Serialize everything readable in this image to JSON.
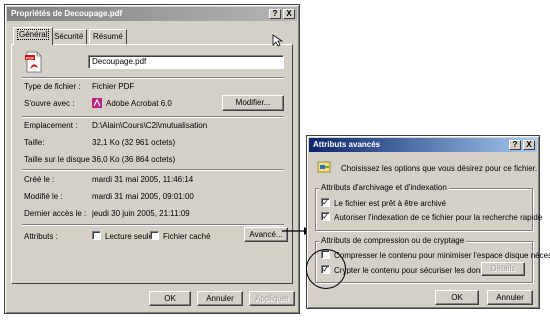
{
  "props": {
    "title": "Propriétés de Decoupage.pdf",
    "tabs": [
      "Général",
      "Sécurité",
      "Résumé"
    ],
    "filename": "Decoupage.pdf",
    "type_label": "Type de fichier :",
    "type_value": "Fichier PDF",
    "opens_label": "S'ouvre avec :",
    "opens_value": "Adobe Acrobat 6.0",
    "modify_btn": "Modifier...",
    "location_label": "Emplacement :",
    "location_value": "D:\\Alain\\Cours\\C2i\\mutualisation",
    "size_label": "Taille:",
    "size_value": "32,1 Ko (32 961 octets)",
    "disksize_label": "Taille sur le disque :",
    "disksize_value": "36,0 Ko (36 864 octets)",
    "created_label": "Créé le :",
    "created_value": "mardi 31 mai 2005, 11:46:14",
    "modified_label": "Modifié le :",
    "modified_value": "mardi 31 mai 2005, 09:01:00",
    "accessed_label": "Dernier accès le :",
    "accessed_value": "jeudi 30 juin 2005, 21:11:09",
    "attributes_label": "Attributs :",
    "readonly_label": "Lecture seule",
    "hidden_label": "Fichier caché",
    "advanced_btn": "Avancé...",
    "ok": "OK",
    "cancel": "Annuler",
    "apply": "Appliquer"
  },
  "adv": {
    "title": "Attributs avancés",
    "intro": "Choisissez les options que vous désirez pour ce fichier.",
    "group1_title": "Attributs d'archivage et d'indexation",
    "archive_label": "Le fichier est prêt à être archivé",
    "index_label": "Autoriser l'indexation de ce fichier pour la recherche rapide",
    "group2_title": "Attributs de compression ou de cryptage",
    "compress_label": "Compresser le contenu pour minimiser l'espace disque nécessaire",
    "encrypt_label": "Crypter le contenu pour sécuriser les données",
    "details_btn": "Détails",
    "ok": "OK",
    "cancel": "Annuler"
  },
  "titlebar_buttons": {
    "help": "?",
    "close": "X"
  },
  "checkmark": "✓"
}
